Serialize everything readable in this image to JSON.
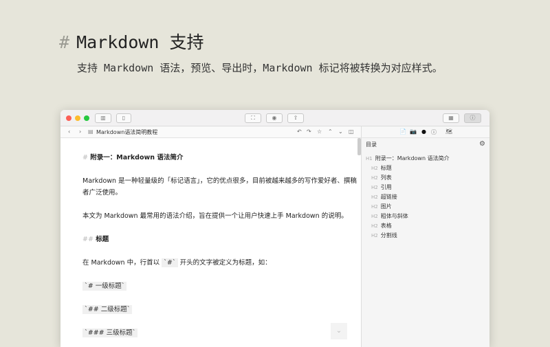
{
  "hero": {
    "hash": "#",
    "title": "Markdown 支持",
    "subtitle": "支持 Markdown 语法，预览、导出时，Markdown 标记将被转换为对应样式。"
  },
  "colors": {
    "close": "#fc5f57",
    "minimize": "#fdbc2e",
    "zoom": "#28c840"
  },
  "toolbar": {
    "left_icons": [
      "library-icon",
      "sidebar-icon"
    ],
    "center_icons": [
      "focus-icon",
      "preview-icon",
      "share-icon"
    ],
    "right_icons": [
      "layout-icon",
      "info-icon"
    ]
  },
  "navbar": {
    "back": "‹",
    "forward": "›",
    "doc_title": "Markdown语法简明教程",
    "undo": "↶",
    "redo": "↷",
    "star": "☆",
    "up": "⌃",
    "down": "⌄",
    "split": "◫"
  },
  "sidetabs": {
    "icons": [
      "📄",
      "📷",
      "●",
      "ⓘ",
      "🗺"
    ]
  },
  "editor": {
    "h1_mark": "#",
    "h1": "附录一：Markdown 语法简介",
    "p1": "Markdown 是一种轻量级的「标记语言」，它的优点很多，目前被越来越多的写作爱好者、撰稿者广泛使用。",
    "p2": "本文为 Markdown 最常用的语法介绍，旨在提供一个让用户快速上手 Markdown 的说明。",
    "h2_mark": "##",
    "h2": "标题",
    "p3_a": "在 Markdown 中，行首以 ",
    "p3_code": "`#`",
    "p3_b": " 开头的文字被定义为标题，如：",
    "code1": "`# 一级标题`",
    "code2": "`## 二级标题`",
    "code3": "`### 三级标题`"
  },
  "sidebar": {
    "title": "目录",
    "toc": [
      {
        "level": "H1",
        "text": "附录一：Markdown 语法简介"
      },
      {
        "level": "H2",
        "text": "标题"
      },
      {
        "level": "H2",
        "text": "列表"
      },
      {
        "level": "H2",
        "text": "引用"
      },
      {
        "level": "H2",
        "text": "超链接"
      },
      {
        "level": "H2",
        "text": "图片"
      },
      {
        "level": "H2",
        "text": "粗体与斜体"
      },
      {
        "level": "H2",
        "text": "表格"
      },
      {
        "level": "H2",
        "text": "分割线"
      }
    ]
  }
}
